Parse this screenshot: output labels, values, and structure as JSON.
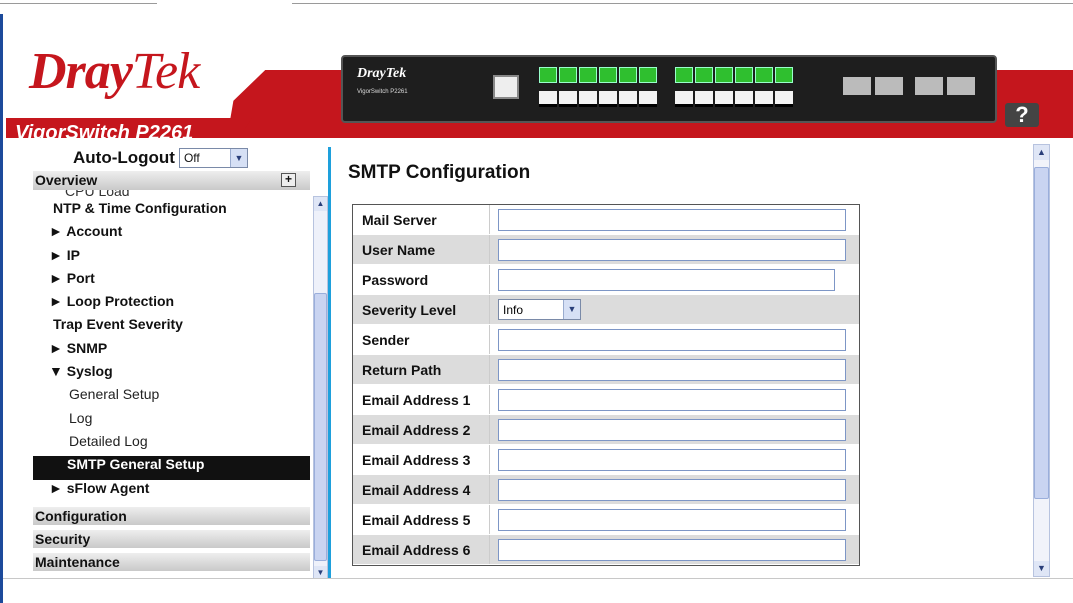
{
  "header": {
    "brand": "Dray",
    "brand_suffix": "Tek",
    "model": "VigorSwitch P2261",
    "device_brand": "DrayTek",
    "device_model": "VigorSwitch P2261",
    "help_label": "?"
  },
  "sidebar": {
    "autologout_label": "Auto-Logout",
    "autologout_value": "Off",
    "overview_label": "Overview",
    "cut_item": "CPU Load",
    "items": [
      {
        "label": "NTP & Time Configuration"
      },
      {
        "label": "► Account"
      },
      {
        "label": "► IP"
      },
      {
        "label": "► Port"
      },
      {
        "label": "► Loop Protection"
      },
      {
        "label": "Trap Event Severity"
      },
      {
        "label": "► SNMP"
      },
      {
        "label": "▼ Syslog"
      },
      {
        "label": "General Setup"
      },
      {
        "label": "Log"
      },
      {
        "label": "Detailed Log"
      },
      {
        "label": "SMTP General Setup"
      },
      {
        "label": "► sFlow Agent"
      }
    ],
    "sections": [
      "Configuration",
      "Security",
      "Maintenance"
    ]
  },
  "main": {
    "title": "SMTP Configuration",
    "fields": [
      {
        "label": "Mail Server",
        "value": ""
      },
      {
        "label": "User Name",
        "value": ""
      },
      {
        "label": "Password",
        "value": ""
      },
      {
        "label": "Severity Level",
        "value": "Info"
      },
      {
        "label": "Sender",
        "value": ""
      },
      {
        "label": "Return Path",
        "value": ""
      },
      {
        "label": "Email Address 1",
        "value": ""
      },
      {
        "label": "Email Address 2",
        "value": ""
      },
      {
        "label": "Email Address 3",
        "value": ""
      },
      {
        "label": "Email Address 4",
        "value": ""
      },
      {
        "label": "Email Address 5",
        "value": ""
      },
      {
        "label": "Email Address 6",
        "value": ""
      }
    ]
  },
  "colors": {
    "brand_red": "#c5161d",
    "accent_blue": "#1ea0dc",
    "frame_blue": "#1c4a9b"
  }
}
